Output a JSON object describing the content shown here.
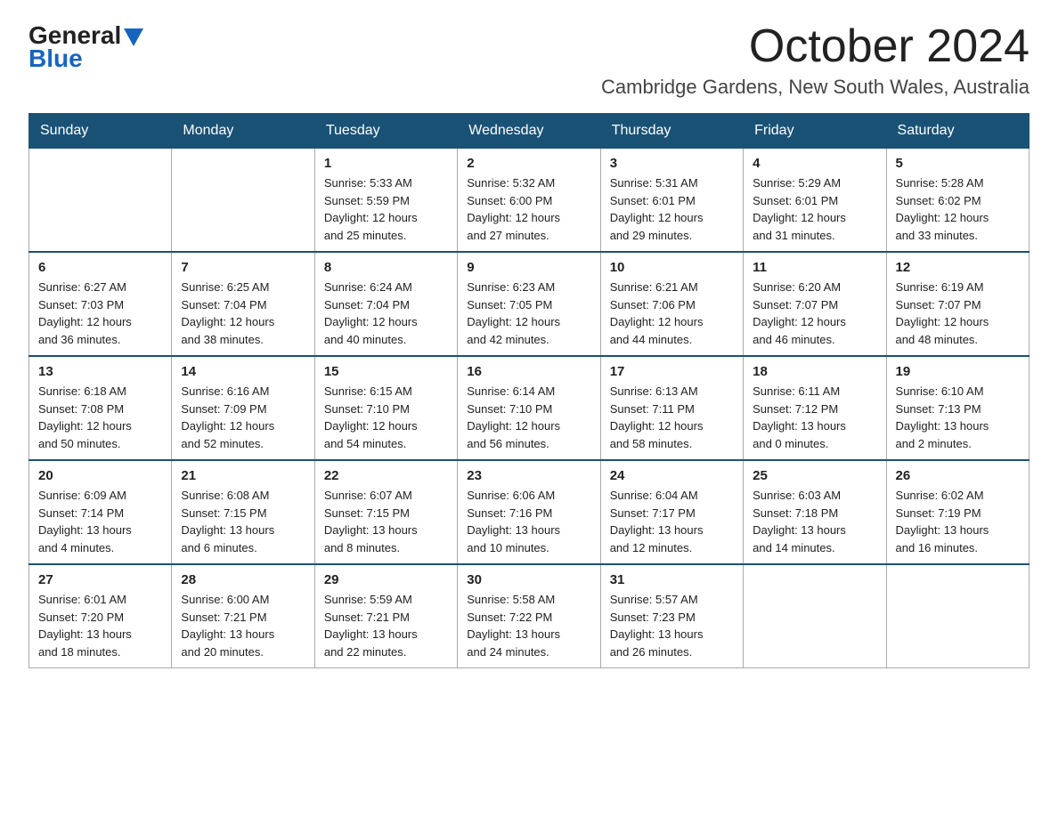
{
  "logo": {
    "text_general": "General",
    "text_blue": "Blue"
  },
  "title": "October 2024",
  "subtitle": "Cambridge Gardens, New South Wales, Australia",
  "days_of_week": [
    "Sunday",
    "Monday",
    "Tuesday",
    "Wednesday",
    "Thursday",
    "Friday",
    "Saturday"
  ],
  "weeks": [
    [
      {
        "day": "",
        "info": ""
      },
      {
        "day": "",
        "info": ""
      },
      {
        "day": "1",
        "info": "Sunrise: 5:33 AM\nSunset: 5:59 PM\nDaylight: 12 hours\nand 25 minutes."
      },
      {
        "day": "2",
        "info": "Sunrise: 5:32 AM\nSunset: 6:00 PM\nDaylight: 12 hours\nand 27 minutes."
      },
      {
        "day": "3",
        "info": "Sunrise: 5:31 AM\nSunset: 6:01 PM\nDaylight: 12 hours\nand 29 minutes."
      },
      {
        "day": "4",
        "info": "Sunrise: 5:29 AM\nSunset: 6:01 PM\nDaylight: 12 hours\nand 31 minutes."
      },
      {
        "day": "5",
        "info": "Sunrise: 5:28 AM\nSunset: 6:02 PM\nDaylight: 12 hours\nand 33 minutes."
      }
    ],
    [
      {
        "day": "6",
        "info": "Sunrise: 6:27 AM\nSunset: 7:03 PM\nDaylight: 12 hours\nand 36 minutes."
      },
      {
        "day": "7",
        "info": "Sunrise: 6:25 AM\nSunset: 7:04 PM\nDaylight: 12 hours\nand 38 minutes."
      },
      {
        "day": "8",
        "info": "Sunrise: 6:24 AM\nSunset: 7:04 PM\nDaylight: 12 hours\nand 40 minutes."
      },
      {
        "day": "9",
        "info": "Sunrise: 6:23 AM\nSunset: 7:05 PM\nDaylight: 12 hours\nand 42 minutes."
      },
      {
        "day": "10",
        "info": "Sunrise: 6:21 AM\nSunset: 7:06 PM\nDaylight: 12 hours\nand 44 minutes."
      },
      {
        "day": "11",
        "info": "Sunrise: 6:20 AM\nSunset: 7:07 PM\nDaylight: 12 hours\nand 46 minutes."
      },
      {
        "day": "12",
        "info": "Sunrise: 6:19 AM\nSunset: 7:07 PM\nDaylight: 12 hours\nand 48 minutes."
      }
    ],
    [
      {
        "day": "13",
        "info": "Sunrise: 6:18 AM\nSunset: 7:08 PM\nDaylight: 12 hours\nand 50 minutes."
      },
      {
        "day": "14",
        "info": "Sunrise: 6:16 AM\nSunset: 7:09 PM\nDaylight: 12 hours\nand 52 minutes."
      },
      {
        "day": "15",
        "info": "Sunrise: 6:15 AM\nSunset: 7:10 PM\nDaylight: 12 hours\nand 54 minutes."
      },
      {
        "day": "16",
        "info": "Sunrise: 6:14 AM\nSunset: 7:10 PM\nDaylight: 12 hours\nand 56 minutes."
      },
      {
        "day": "17",
        "info": "Sunrise: 6:13 AM\nSunset: 7:11 PM\nDaylight: 12 hours\nand 58 minutes."
      },
      {
        "day": "18",
        "info": "Sunrise: 6:11 AM\nSunset: 7:12 PM\nDaylight: 13 hours\nand 0 minutes."
      },
      {
        "day": "19",
        "info": "Sunrise: 6:10 AM\nSunset: 7:13 PM\nDaylight: 13 hours\nand 2 minutes."
      }
    ],
    [
      {
        "day": "20",
        "info": "Sunrise: 6:09 AM\nSunset: 7:14 PM\nDaylight: 13 hours\nand 4 minutes."
      },
      {
        "day": "21",
        "info": "Sunrise: 6:08 AM\nSunset: 7:15 PM\nDaylight: 13 hours\nand 6 minutes."
      },
      {
        "day": "22",
        "info": "Sunrise: 6:07 AM\nSunset: 7:15 PM\nDaylight: 13 hours\nand 8 minutes."
      },
      {
        "day": "23",
        "info": "Sunrise: 6:06 AM\nSunset: 7:16 PM\nDaylight: 13 hours\nand 10 minutes."
      },
      {
        "day": "24",
        "info": "Sunrise: 6:04 AM\nSunset: 7:17 PM\nDaylight: 13 hours\nand 12 minutes."
      },
      {
        "day": "25",
        "info": "Sunrise: 6:03 AM\nSunset: 7:18 PM\nDaylight: 13 hours\nand 14 minutes."
      },
      {
        "day": "26",
        "info": "Sunrise: 6:02 AM\nSunset: 7:19 PM\nDaylight: 13 hours\nand 16 minutes."
      }
    ],
    [
      {
        "day": "27",
        "info": "Sunrise: 6:01 AM\nSunset: 7:20 PM\nDaylight: 13 hours\nand 18 minutes."
      },
      {
        "day": "28",
        "info": "Sunrise: 6:00 AM\nSunset: 7:21 PM\nDaylight: 13 hours\nand 20 minutes."
      },
      {
        "day": "29",
        "info": "Sunrise: 5:59 AM\nSunset: 7:21 PM\nDaylight: 13 hours\nand 22 minutes."
      },
      {
        "day": "30",
        "info": "Sunrise: 5:58 AM\nSunset: 7:22 PM\nDaylight: 13 hours\nand 24 minutes."
      },
      {
        "day": "31",
        "info": "Sunrise: 5:57 AM\nSunset: 7:23 PM\nDaylight: 13 hours\nand 26 minutes."
      },
      {
        "day": "",
        "info": ""
      },
      {
        "day": "",
        "info": ""
      }
    ]
  ]
}
